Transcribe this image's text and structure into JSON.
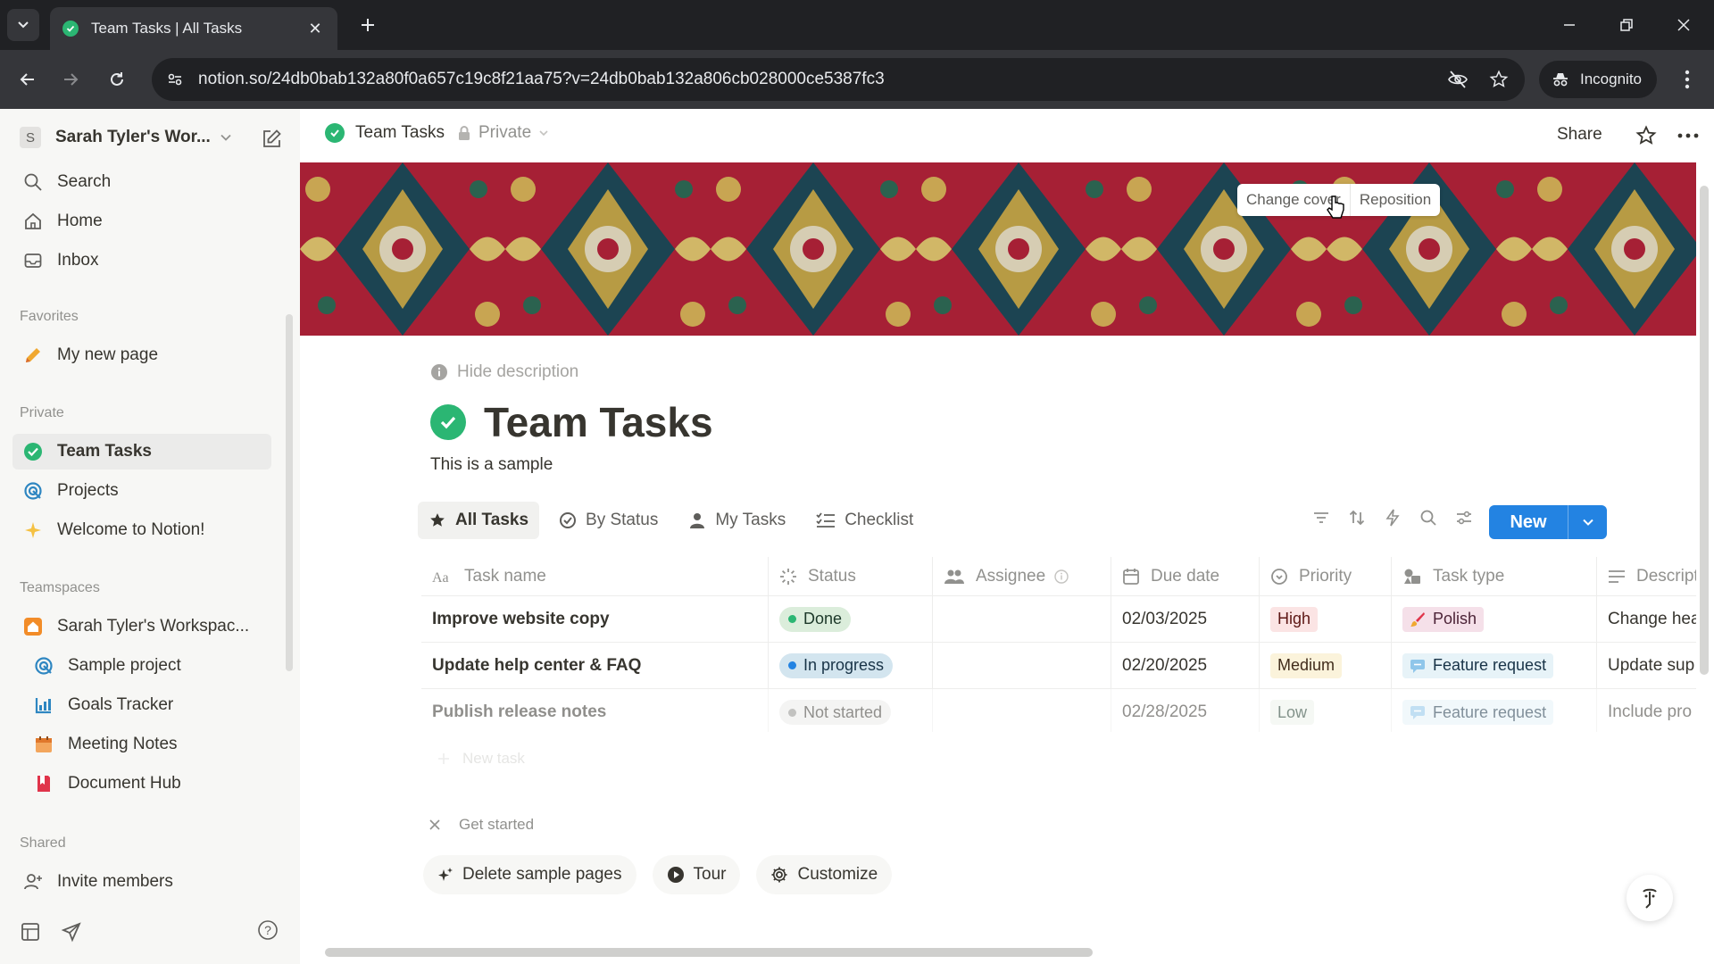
{
  "browser": {
    "tab_title": "Team Tasks | All Tasks",
    "url": "notion.so/24db0bab132a80f0a657c19c8f21aa75?v=24db0bab132a806cb028000ce5387fc3",
    "incognito_label": "Incognito"
  },
  "sidebar": {
    "workspace_initial": "S",
    "workspace_name": "Sarah Tyler's Wor...",
    "top_items": [
      {
        "label": "Search",
        "icon": "search-icon"
      },
      {
        "label": "Home",
        "icon": "home-icon"
      },
      {
        "label": "Inbox",
        "icon": "inbox-icon"
      }
    ],
    "favorites_heading": "Favorites",
    "favorites": [
      {
        "label": "My new page",
        "icon": "pencil-icon"
      }
    ],
    "private_heading": "Private",
    "private": [
      {
        "label": "Team Tasks",
        "icon": "check-circle-icon",
        "active": true
      },
      {
        "label": "Projects",
        "icon": "target-icon"
      },
      {
        "label": "Welcome to Notion!",
        "icon": "sparkle-icon"
      }
    ],
    "teamspaces_heading": "Teamspaces",
    "teamspace_name": "Sarah Tyler's Workspac...",
    "teamspace_items": [
      {
        "label": "Sample project",
        "icon": "target-icon"
      },
      {
        "label": "Goals Tracker",
        "icon": "chart-icon"
      },
      {
        "label": "Meeting Notes",
        "icon": "calendar-icon"
      },
      {
        "label": "Document Hub",
        "icon": "book-icon"
      }
    ],
    "shared_heading": "Shared",
    "invite_label": "Invite members"
  },
  "topbar": {
    "page_name": "Team Tasks",
    "privacy": "Private",
    "share_label": "Share"
  },
  "cover": {
    "change_label": "Change cover",
    "reposition_label": "Reposition"
  },
  "page": {
    "hide_description": "Hide description",
    "title": "Team Tasks",
    "description": "This is a sample"
  },
  "views": [
    {
      "label": "All Tasks",
      "icon": "star-icon",
      "active": true
    },
    {
      "label": "By Status",
      "icon": "status-icon"
    },
    {
      "label": "My Tasks",
      "icon": "person-icon"
    },
    {
      "label": "Checklist",
      "icon": "checklist-icon"
    }
  ],
  "new_button": "New",
  "table": {
    "columns": [
      "Task name",
      "Status",
      "Assignee",
      "Due date",
      "Priority",
      "Task type",
      "Description"
    ],
    "rows": [
      {
        "name": "Improve website copy",
        "status": "Done",
        "assignee": "",
        "due": "02/03/2025",
        "priority": "High",
        "type": "Polish",
        "description": "Change hea"
      },
      {
        "name": "Update help center & FAQ",
        "status": "In progress",
        "assignee": "",
        "due": "02/20/2025",
        "priority": "Medium",
        "type": "Feature request",
        "description": "Update sup"
      },
      {
        "name": "Publish release notes",
        "status": "Not started",
        "assignee": "",
        "due": "02/28/2025",
        "priority": "Low",
        "type": "Feature request",
        "description": "Include pro"
      }
    ],
    "new_task": "New task"
  },
  "get_started": {
    "heading": "Get started",
    "buttons": [
      {
        "label": "Delete sample pages",
        "icon": "sparkle-icon"
      },
      {
        "label": "Tour",
        "icon": "play-icon"
      },
      {
        "label": "Customize",
        "icon": "gear-icon"
      }
    ]
  },
  "colors": {
    "accent_blue": "#2383e2",
    "done_green": "#2bb673",
    "high_red": "#fbe4e4",
    "medium_yellow": "#fbf3db",
    "polish_pink": "#f5e0e9"
  }
}
